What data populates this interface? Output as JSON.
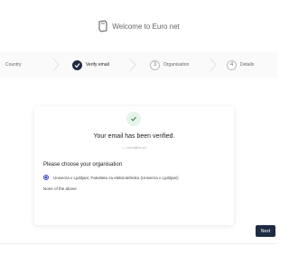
{
  "header": {
    "title": "Welcome to Euro net"
  },
  "stepper": {
    "steps": [
      {
        "label": "Country",
        "active": false
      },
      {
        "label": "Verify email",
        "active": true
      },
      {
        "number": "3",
        "label": "Organisation",
        "active": false
      },
      {
        "number": "4",
        "label": "Details",
        "active": false
      }
    ]
  },
  "card": {
    "verified_message": "Your email has been verified.",
    "verified_email": "— ••••••@•••.•••",
    "org_heading": "Please choose your organisation",
    "options": [
      {
        "label": "Univerza v Ljubljani, Fakulteta za elektrotehniko (Univerza v Ljubljani)",
        "checked": true
      },
      {
        "label": "None of the above",
        "checked": false
      }
    ]
  },
  "footer": {
    "next_label": "Next"
  },
  "colors": {
    "primary": "#1f2a44",
    "success": "#2e7d32",
    "radio_accent": "#3b4cc0"
  }
}
